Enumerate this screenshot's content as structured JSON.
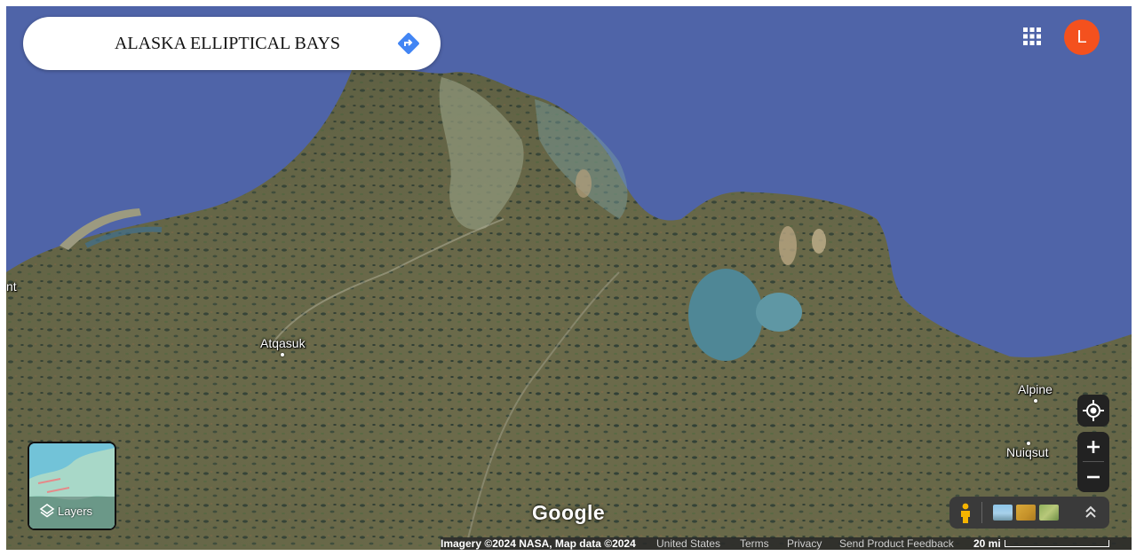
{
  "search": {
    "title": "ALASKA ELLIPTICAL BAYS"
  },
  "account": {
    "avatar_letter": "L",
    "avatar_color": "#f4511e"
  },
  "places": {
    "left_cut": "nt",
    "atqasuk": "Atqasuk",
    "alpine": "Alpine",
    "nuiqsut": "Nuiqsut"
  },
  "layers": {
    "label": "Layers"
  },
  "logo": "Google",
  "attribution": {
    "imagery": "Imagery ©2024 NASA, Map data ©2024",
    "region": "United States",
    "terms": "Terms",
    "privacy": "Privacy",
    "feedback": "Send Product Feedback",
    "scale": "20 mi"
  },
  "colors": {
    "ocean": "#4f64a8",
    "land": "#6b6a4a",
    "controls_bg": "#222222"
  }
}
